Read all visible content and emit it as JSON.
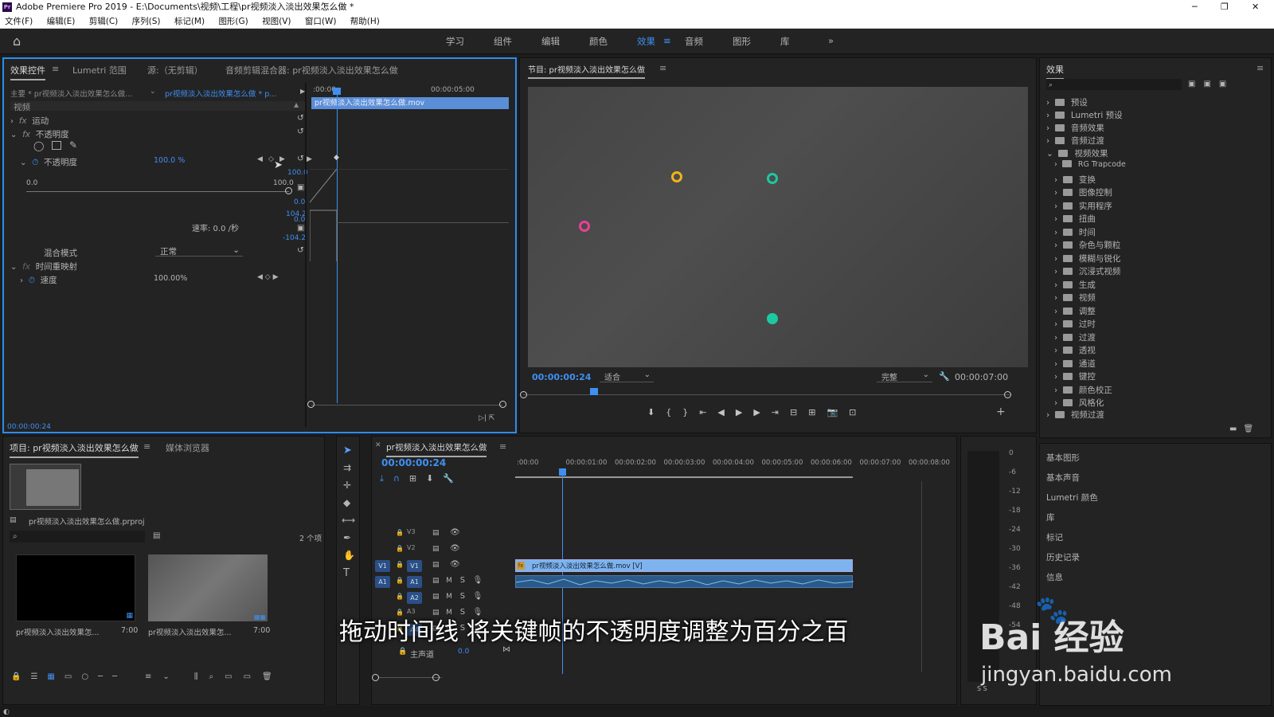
{
  "window": {
    "title": "Adobe Premiere Pro 2019 - E:\\Documents\\视频\\工程\\pr视频淡入淡出效果怎么做 *",
    "app_icon": "Pr"
  },
  "menu": [
    "文件(F)",
    "编辑(E)",
    "剪辑(C)",
    "序列(S)",
    "标记(M)",
    "图形(G)",
    "视图(V)",
    "窗口(W)",
    "帮助(H)"
  ],
  "workspaces": [
    "学习",
    "组件",
    "编辑",
    "颜色",
    "效果",
    "音频",
    "图形",
    "库"
  ],
  "active_workspace": "效果",
  "effect_controls": {
    "tabs": [
      "效果控件",
      "Lumetri 范围",
      "源:（无剪辑）",
      "音频剪辑混合器: pr视频淡入淡出效果怎么做"
    ],
    "master": "主要 * pr视频淡入淡出效果怎么做...",
    "clip": "pr视频淡入淡出效果怎么做 * p...",
    "section_video": "视频",
    "motion": "运动",
    "opacity_group": "不透明度",
    "opacity_label": "不透明度",
    "opacity_value": "100.0 %",
    "slider_min": "0.0",
    "slider_max": "100.0",
    "graph_top": "100.0",
    "graph_zero": "0.0",
    "graph_vel_top": "104.2",
    "graph_vel_zero": "0.0",
    "graph_vel_bottom": "-104.2",
    "rate": "速率: 0.0 /秒",
    "blend_label": "混合模式",
    "blend_value": "正常",
    "time_remap": "时间重映射",
    "speed_label": "速度",
    "speed_value": "100.00%",
    "ruler_start": ":00:00",
    "ruler_mid": "00:00:05:00",
    "clip_bar": "pr视频淡入淡出效果怎么做.mov",
    "timecode": "00:00:00:24"
  },
  "program": {
    "title": "节目: pr视频淡入淡出效果怎么做",
    "timecode": "00:00:00:24",
    "fit": "适合",
    "quality": "完整",
    "duration": "00:00:07:00"
  },
  "effects": {
    "title": "效果",
    "items": [
      "预设",
      "Lumetri 预设",
      "音频效果",
      "音频过渡",
      "视频效果"
    ],
    "sub": [
      "RG Trapcode",
      "变换",
      "图像控制",
      "实用程序",
      "扭曲",
      "时间",
      "杂色与颗粒",
      "模糊与锐化",
      "沉浸式视频",
      "生成",
      "视频",
      "调整",
      "过时",
      "过渡",
      "透视",
      "通道",
      "键控",
      "颜色校正",
      "风格化"
    ],
    "last": "视频过渡",
    "panels": [
      "基本图形",
      "基本声音",
      "Lumetri 颜色",
      "库",
      "标记",
      "历史记录",
      "信息"
    ]
  },
  "project": {
    "tabs": [
      "项目: pr视频淡入淡出效果怎么做",
      "媒体浏览器"
    ],
    "file": "pr视频淡入淡出效果怎么做.prproj",
    "count": "2 个项",
    "items": [
      {
        "name": "pr视频淡入淡出效果怎...",
        "dur": "7:00"
      },
      {
        "name": "pr视频淡入淡出效果怎...",
        "dur": "7:00"
      }
    ]
  },
  "timeline": {
    "title": "pr视频淡入淡出效果怎么做",
    "timecode": "00:00:00:24",
    "ruler": [
      ":00:00",
      "00:00:01:00",
      "00:00:02:00",
      "00:00:03:00",
      "00:00:04:00",
      "00:00:05:00",
      "00:00:06:00",
      "00:00:07:00",
      "00:00:08:00"
    ],
    "tracks": [
      "V3",
      "V2",
      "V1",
      "A1",
      "A2",
      "A3",
      "A4"
    ],
    "source_v": "V1",
    "source_a": "A1",
    "master": "主声道",
    "master_val": "0.0",
    "clip": "pr视频淡入淡出效果怎么做.mov [V]"
  },
  "meter": [
    "0",
    "-6",
    "-12",
    "-18",
    "-24",
    "-30",
    "-36",
    "-42",
    "-48",
    "-54"
  ],
  "subtitle": "拖动时间线 将关键帧的不透明度调整为百分之百",
  "watermark": {
    "brand": "Bai 经验",
    "url": "jingyan.baidu.com"
  }
}
